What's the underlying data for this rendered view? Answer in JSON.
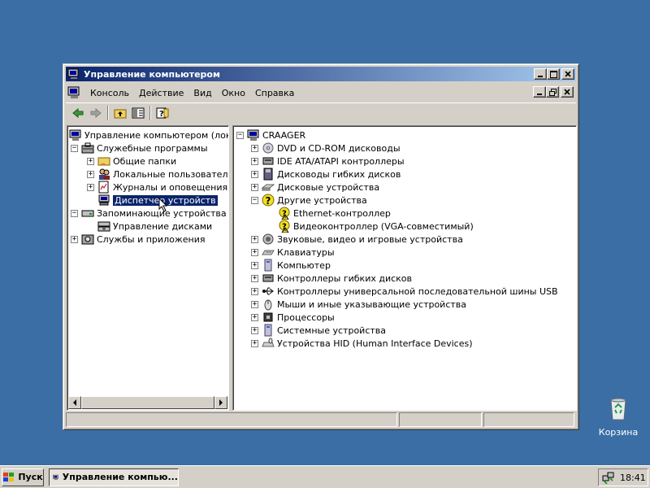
{
  "window": {
    "title": "Управление компьютером",
    "controls": [
      "minimize",
      "maximize",
      "close"
    ]
  },
  "menubar": {
    "items": [
      "Консоль",
      "Действие",
      "Вид",
      "Окно",
      "Справка"
    ]
  },
  "toolbar": {
    "icons": [
      "back-arrow-icon",
      "forward-arrow-icon",
      "up-folder-icon",
      "show-hide-tree-icon",
      "help-icon"
    ]
  },
  "left_tree": {
    "root": "Управление компьютером (локаль",
    "system_tools": "Служебные программы",
    "shared_folders": "Общие папки",
    "local_users": "Локальные пользователи и",
    "event_logs": "Журналы и оповещения пр",
    "device_manager": "Диспетчер устройств",
    "storage": "Запоминающие устройства",
    "disk_management": "Управление дисками",
    "services_apps": "Службы и приложения"
  },
  "device_tree": {
    "computer_name": "CRAAGER",
    "dvd": "DVD и CD-ROM дисководы",
    "ide": "IDE ATA/ATAPI контроллеры",
    "floppy_drives": "Дисководы гибких дисков",
    "disk_drives": "Дисковые устройства",
    "other_devices": "Другие устройства",
    "ethernet": "Ethernet-контроллер",
    "video": "Видеоконтроллер (VGA-совместимый)",
    "sound": "Звуковые, видео и игровые устройства",
    "keyboards": "Клавиатуры",
    "computer": "Компьютер",
    "floppy_controllers": "Контроллеры гибких дисков",
    "usb": "Контроллеры универсальной последовательной шины USB",
    "mice": "Мыши и иные указывающие устройства",
    "processors": "Процессоры",
    "system_devices": "Системные устройства",
    "hid": "Устройства HID (Human Interface Devices)"
  },
  "desktop": {
    "recycle_bin": "Корзина"
  },
  "taskbar": {
    "start": "Пуск",
    "task_label": "Управление компью...",
    "clock": "18:41"
  },
  "colors": {
    "desktop": "#3a6ea5",
    "title_active_start": "#0a246a",
    "title_active_end": "#a6caf0",
    "face": "#d4d0c8",
    "selection": "#0a246a"
  }
}
